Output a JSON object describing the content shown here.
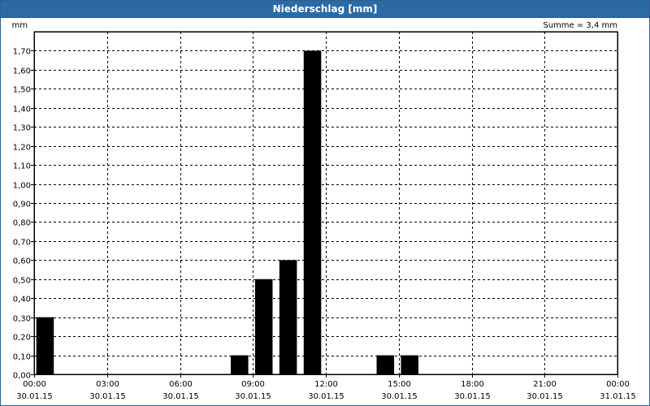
{
  "window": {
    "title": "Niederschlag [mm]"
  },
  "chart_data": {
    "type": "bar",
    "title": "Niederschlag [mm]",
    "ylabel": "mm",
    "summary": "Summe = 3,4 mm",
    "ylim": [
      0,
      1.8
    ],
    "y_ticks": [
      "0,00",
      "0,10",
      "0,20",
      "0,30",
      "0,40",
      "0,50",
      "0,60",
      "0,70",
      "0,80",
      "0,90",
      "1,00",
      "1,10",
      "1,20",
      "1,30",
      "1,40",
      "1,50",
      "1,60",
      "1,70"
    ],
    "x_tick_times": [
      "00:00",
      "03:00",
      "06:00",
      "09:00",
      "12:00",
      "15:00",
      "18:00",
      "21:00",
      "00:00"
    ],
    "x_tick_dates": [
      "30.01.15",
      "30.01.15",
      "30.01.15",
      "30.01.15",
      "30.01.15",
      "30.01.15",
      "30.01.15",
      "30.01.15",
      "31.01.15"
    ],
    "x_range_hours": [
      0,
      24
    ],
    "grid": true,
    "bars": [
      {
        "hour": 0,
        "value": 0.3
      },
      {
        "hour": 8,
        "value": 0.1
      },
      {
        "hour": 9,
        "value": 0.5
      },
      {
        "hour": 10,
        "value": 0.6
      },
      {
        "hour": 11,
        "value": 1.7
      },
      {
        "hour": 14,
        "value": 0.1
      },
      {
        "hour": 15,
        "value": 0.1
      }
    ],
    "bar_color": "#000000"
  }
}
